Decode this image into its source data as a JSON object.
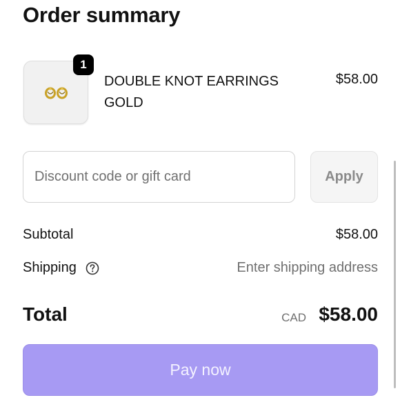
{
  "summary": {
    "title": "Order summary"
  },
  "line_item": {
    "quantity": "1",
    "name": "DOUBLE KNOT EARRINGS GOLD",
    "price": "$58.00",
    "image_icon": "gold-earrings-image"
  },
  "discount": {
    "placeholder": "Discount code or gift card",
    "value": "",
    "apply_label": "Apply"
  },
  "totals": {
    "subtotal_label": "Subtotal",
    "subtotal_value": "$58.00",
    "shipping_label": "Shipping",
    "shipping_value": "Enter shipping address",
    "shipping_help_icon": "question-circle-icon",
    "total_label": "Total",
    "currency": "CAD",
    "total_value": "$58.00"
  },
  "actions": {
    "pay_label": "Pay now"
  },
  "colors": {
    "pay_button": "#a79af3",
    "badge": "#000000"
  }
}
